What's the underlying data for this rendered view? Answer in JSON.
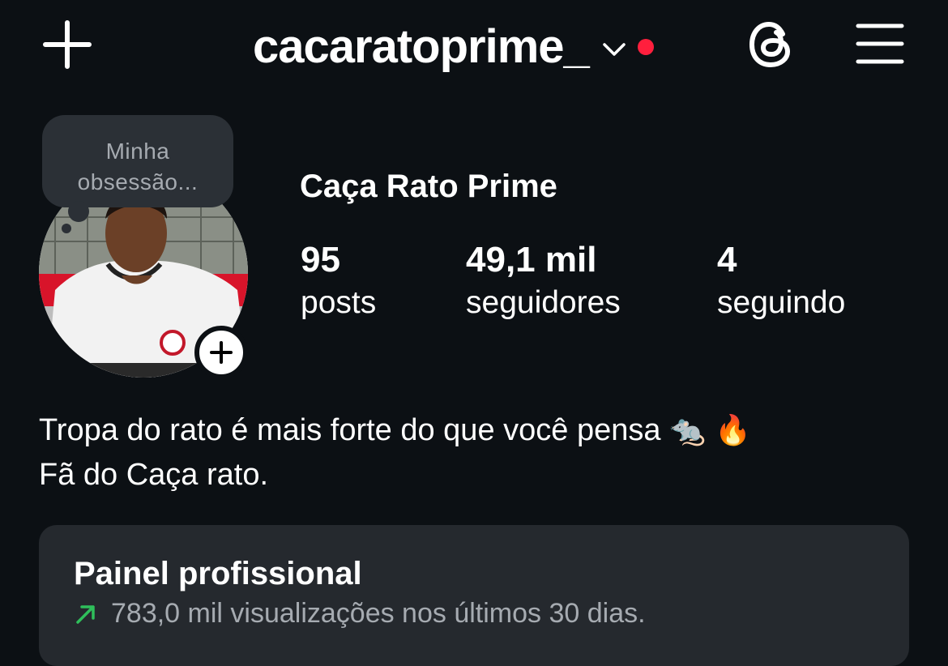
{
  "header": {
    "username": "cacaratoprime_",
    "icons": [
      "plus-icon",
      "chevron-down-icon",
      "notification-dot",
      "threads-icon",
      "menu-icon"
    ],
    "accent_red": "#ff1f3d"
  },
  "note": {
    "text_line1": "Minha",
    "text_line2": "obsessão..."
  },
  "profile": {
    "display_name": "Caça Rato Prime",
    "stats": [
      {
        "value": "95",
        "label": "posts"
      },
      {
        "value": "49,1 mil",
        "label": "seguidores"
      },
      {
        "value": "4",
        "label": "seguindo"
      }
    ]
  },
  "bio": {
    "line1": "Tropa do rato é mais forte do que você pensa",
    "line1_emojis": "🐀 🔥",
    "line2": "Fã do Caça rato."
  },
  "dashboard": {
    "title": "Painel profissional",
    "subtitle": "783,0 mil visualizações nos últimos 30 dias.",
    "trend_color": "#2fbf5b"
  }
}
